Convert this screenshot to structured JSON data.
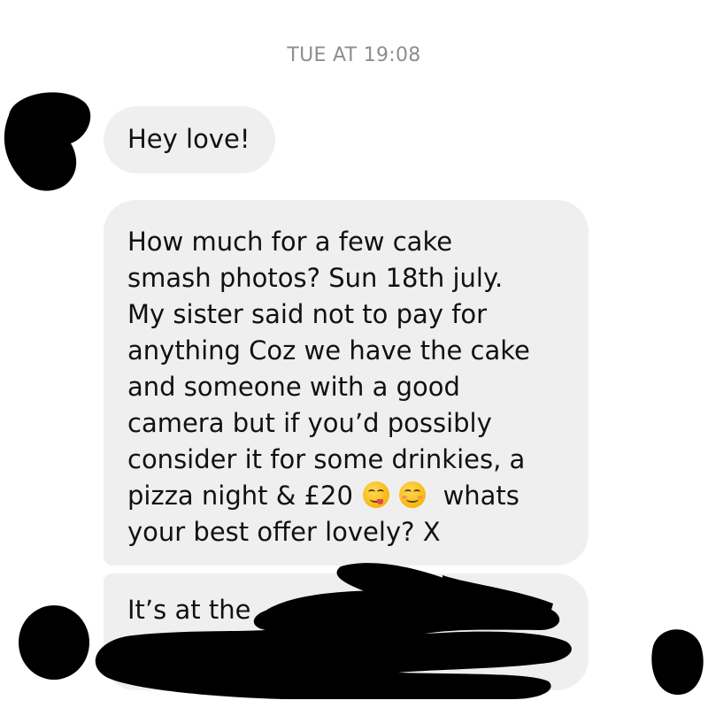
{
  "conversation": {
    "timestamp": "TUE AT 19:08",
    "messages": [
      {
        "text": "Hey love!"
      },
      {
        "lines": [
          "How much for a few cake",
          "smash photos? Sun 18th july.",
          "My sister said not to pay for",
          "anything Coz we have the cake",
          "and someone with a good",
          "camera but if you’d possibly",
          "consider it for some drinkies, a",
          "pizza night & £20",
          "whats",
          "your best offer lovely? X"
        ],
        "emojis": [
          "face-savoring-food-icon",
          "smiling-face-icon"
        ]
      },
      {
        "text": "It’s at the"
      }
    ]
  }
}
